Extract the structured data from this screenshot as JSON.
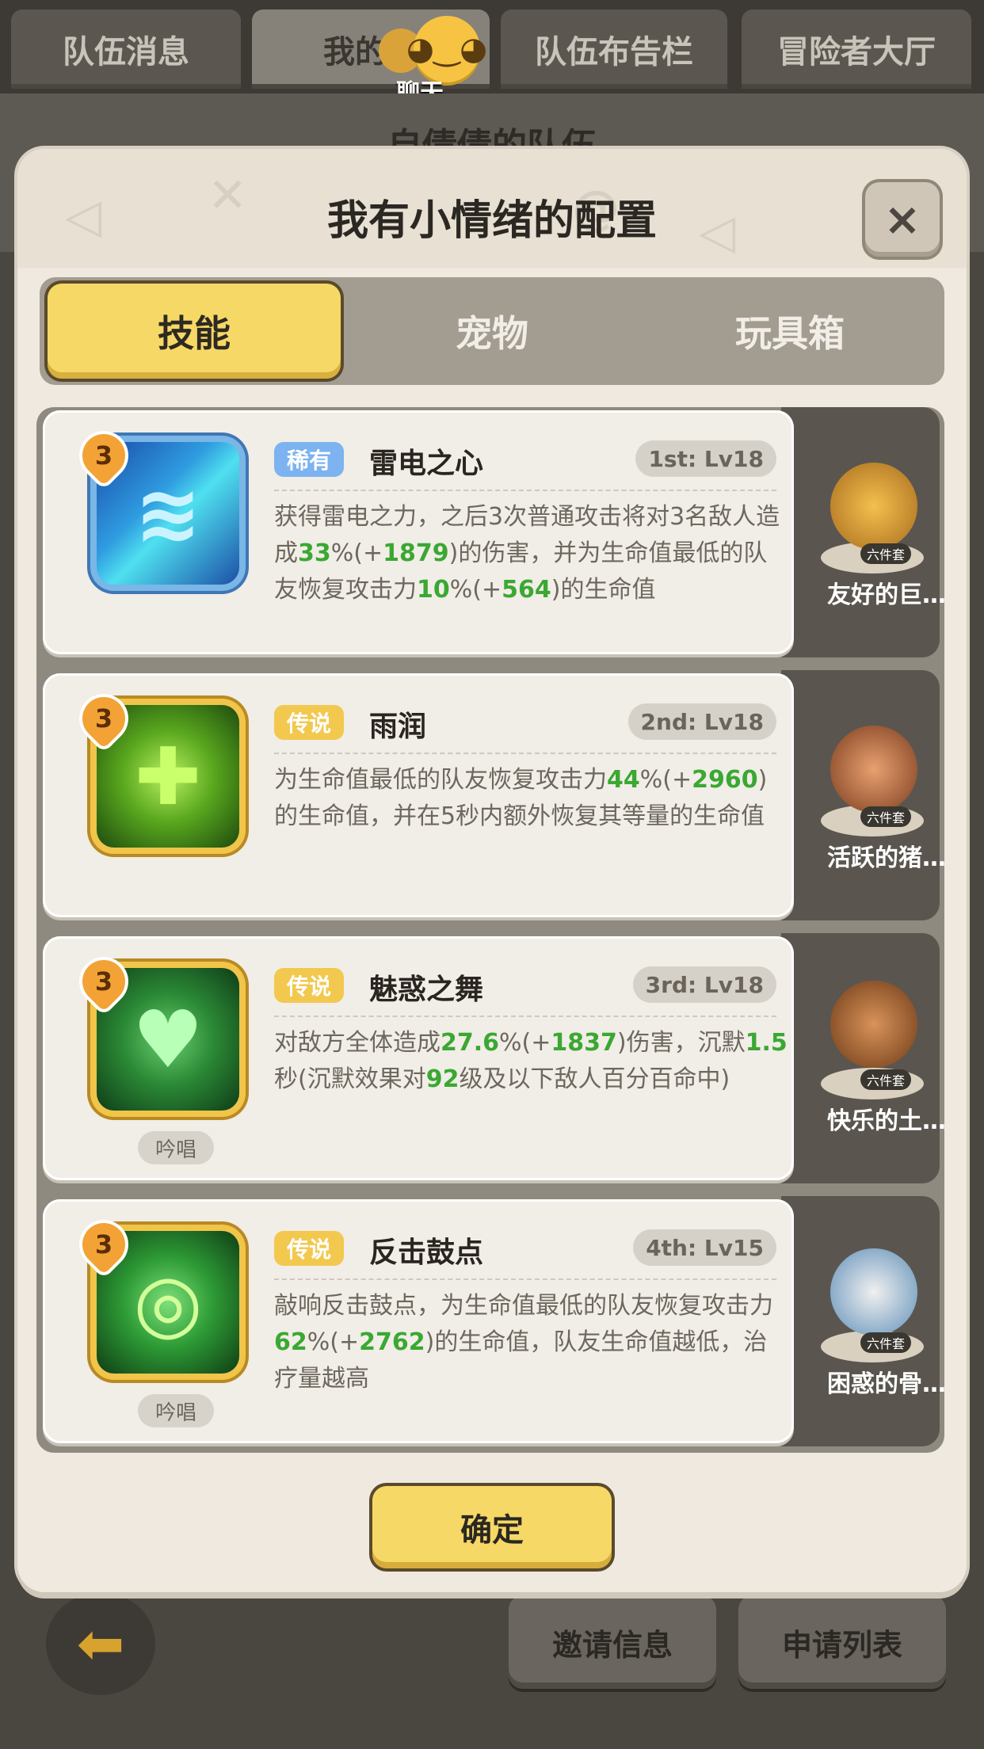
{
  "top_tabs": [
    {
      "label": "队伍消息"
    },
    {
      "label": "我的队"
    },
    {
      "label": "队伍布告栏"
    },
    {
      "label": "冒险者大厅"
    }
  ],
  "chat": {
    "label": "聊天"
  },
  "background_title": "自倩倩的队伍",
  "dialog": {
    "title": "我有小情绪的配置",
    "close_icon": "×",
    "tabs": [
      {
        "label": "技能",
        "active": true
      },
      {
        "label": "宠物",
        "active": false
      },
      {
        "label": "玩具箱",
        "active": false
      }
    ],
    "skills": [
      {
        "level": "3",
        "rarity": "稀有",
        "name": "雷电之心",
        "slot": "1st: Lv18",
        "chant": "",
        "desc_parts": [
          "获得雷电之力，之后3次普通攻击将对3名敌人造成",
          "33",
          "%(+",
          "1879",
          ")的伤害，并为生命值最低的队友恢复攻击力",
          "10",
          "%(+",
          "564",
          ")的生命值"
        ],
        "pet": {
          "name": "友好的巨…",
          "badge": "六件套"
        }
      },
      {
        "level": "3",
        "rarity": "传说",
        "name": "雨润",
        "slot": "2nd: Lv18",
        "chant": "",
        "desc_parts": [
          "为生命值最低的队友恢复攻击力",
          "44",
          "%(+",
          "2960",
          ")的生命值，并在5秒内额外恢复其等量的生命值",
          "",
          "",
          "",
          ""
        ],
        "pet": {
          "name": "活跃的猪…",
          "badge": "六件套"
        }
      },
      {
        "level": "3",
        "rarity": "传说",
        "name": "魅惑之舞",
        "slot": "3rd: Lv18",
        "chant": "吟唱",
        "desc_parts": [
          "对敌方全体造成",
          "27.6",
          "%(+",
          "1837",
          ")伤害，沉默",
          "1.5",
          "秒(沉默效果对",
          "92",
          "级及以下敌人百分百命中)"
        ],
        "pet": {
          "name": "快乐的土…",
          "badge": "六件套"
        }
      },
      {
        "level": "3",
        "rarity": "传说",
        "name": "反击鼓点",
        "slot": "4th: Lv15",
        "chant": "吟唱",
        "desc_parts": [
          "敲响反击鼓点，为生命值最低的队友恢复攻击力",
          "62",
          "%(+",
          "2762",
          ")的生命值，队友生命值越低，治疗量越高",
          "",
          "",
          "",
          ""
        ],
        "pet": {
          "name": "困惑的骨…",
          "badge": "六件套"
        }
      }
    ],
    "confirm_label": "确定"
  },
  "bottom": {
    "back_icon": "arrow-left-icon",
    "invite_label": "邀请信息",
    "apply_label": "申请列表"
  }
}
